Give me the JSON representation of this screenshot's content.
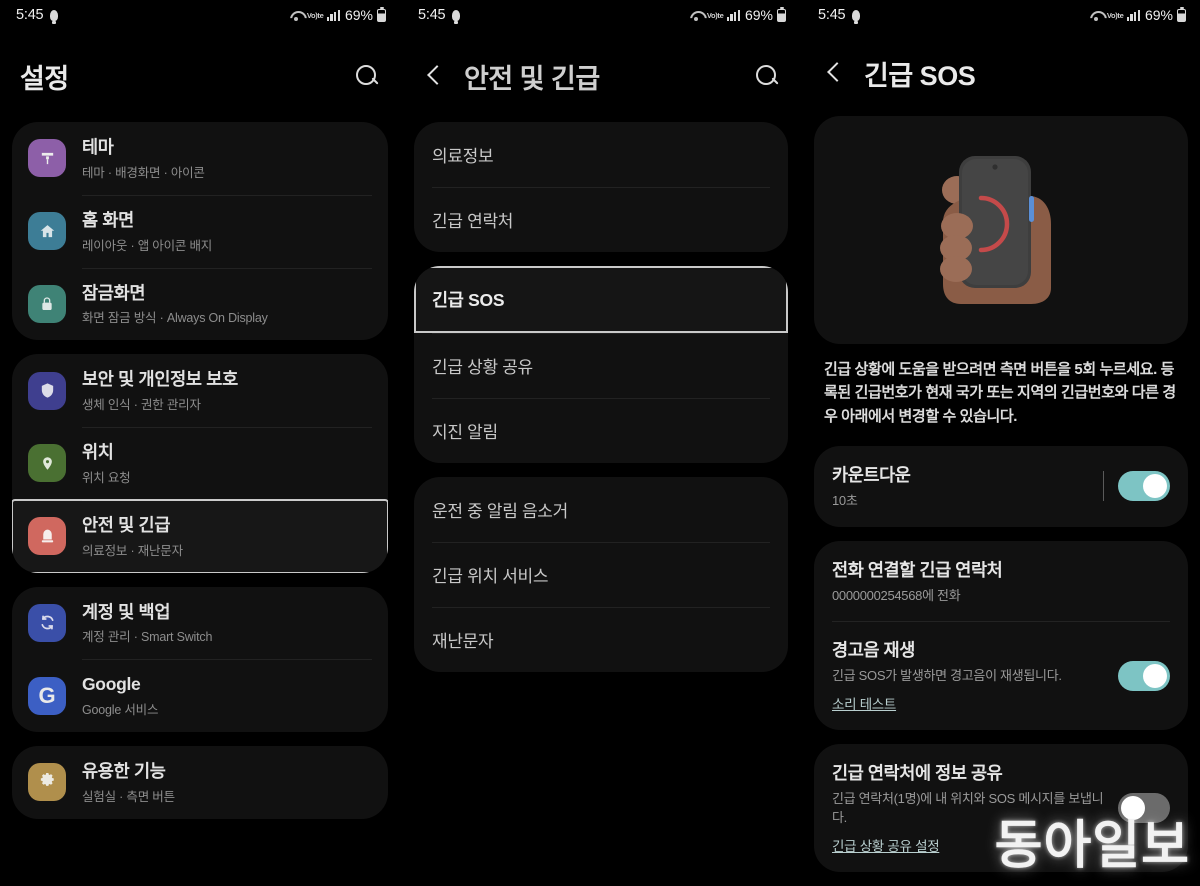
{
  "status_bar": {
    "time": "5:45",
    "battery_text": "69%",
    "network_label": "Vo)te",
    "icons": [
      "bulb-icon",
      "wifi-icon",
      "volte-icon",
      "signal-bars-icon",
      "battery-icon"
    ]
  },
  "colors": {
    "screen_bg": "#000000",
    "card_bg": "#111111",
    "selection_border": "#c9c9c9",
    "toggle_on": "#7dc4c4",
    "toggle_off": "#6b6b6b",
    "link": "#b9cfcf"
  },
  "panel1": {
    "title": "설정",
    "search_label": "검색",
    "groups": [
      {
        "items": [
          {
            "title": "테마",
            "sub": "테마 · 배경화면 · 아이콘",
            "icon": "brush-icon",
            "color": "#8d5fa8",
            "selected": false
          },
          {
            "title": "홈 화면",
            "sub": "레이아웃 · 앱 아이콘 배지",
            "icon": "home-icon",
            "color": "#3d7d96",
            "selected": false
          },
          {
            "title": "잠금화면",
            "sub": "화면 잠금 방식 · Always On Display",
            "icon": "lock-icon",
            "color": "#3f8376",
            "selected": false
          }
        ]
      },
      {
        "items": [
          {
            "title": "보안 및 개인정보 보호",
            "sub": "생체 인식 · 권한 관리자",
            "icon": "shield-icon",
            "color": "#3f3f8f",
            "selected": false
          },
          {
            "title": "위치",
            "sub": "위치 요청",
            "icon": "location-pin-icon",
            "color": "#4a7032",
            "selected": false
          },
          {
            "title": "안전 및 긴급",
            "sub": "의료정보 · 재난문자",
            "icon": "siren-icon",
            "color": "#d0685f",
            "selected": true
          }
        ]
      },
      {
        "items": [
          {
            "title": "계정 및 백업",
            "sub": "계정 관리 · Smart Switch",
            "icon": "sync-icon",
            "color": "#3a4fa8",
            "selected": false
          },
          {
            "title": "Google",
            "sub": "Google 서비스",
            "icon": "google-g-icon",
            "color": "#3c5fc4",
            "selected": false
          }
        ]
      },
      {
        "items": [
          {
            "title": "유용한 기능",
            "sub": "실험실 · 측면 버튼",
            "icon": "gear-icon",
            "color": "#b08f4c",
            "selected": false
          }
        ]
      }
    ]
  },
  "panel2": {
    "title": "안전 및 긴급",
    "groups": [
      {
        "items": [
          {
            "label": "의료정보",
            "selected": false
          },
          {
            "label": "긴급 연락처",
            "selected": false
          }
        ]
      },
      {
        "items": [
          {
            "label": "긴급 SOS",
            "selected": true
          },
          {
            "label": "긴급 상황 공유",
            "selected": false
          },
          {
            "label": "지진 알림",
            "selected": false
          }
        ]
      },
      {
        "items": [
          {
            "label": "운전 중 알림 음소거",
            "selected": false
          },
          {
            "label": "긴급 위치 서비스",
            "selected": false
          },
          {
            "label": "재난문자",
            "selected": false
          }
        ]
      }
    ]
  },
  "panel3": {
    "title": "긴급 SOS",
    "hero_icon": "hand-holding-phone-illustration",
    "description": "긴급 상황에 도움을 받으려면 측면 버튼을 5회 누르세요. 등록된 긴급번호가 현재 국가 또는 지역의 긴급번호와 다른 경우 아래에서 변경할 수 있습니다.",
    "settings": [
      {
        "title": "카운트다운",
        "sub": "10초",
        "link": null,
        "toggle": "on",
        "has_divider": true
      },
      {
        "title": "전화 연결할 긴급 연락처",
        "sub": "0000000254568에 전화",
        "link": null,
        "toggle": null,
        "has_divider": false
      },
      {
        "title": "경고음 재생",
        "sub": "긴급 SOS가 발생하면 경고음이 재생됩니다.",
        "link": "소리 테스트",
        "toggle": "on",
        "has_divider": false
      },
      {
        "title": "긴급 연락처에 정보 공유",
        "sub": "긴급 연락처(1명)에 내 위치와 SOS 메시지를 보냅니다.",
        "link": "긴급 상황 공유 설정",
        "toggle": "off",
        "has_divider": false
      }
    ],
    "watermark": "동아일보"
  }
}
